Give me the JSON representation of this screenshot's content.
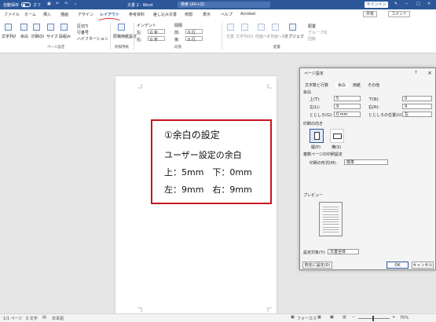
{
  "titlebar": {
    "autosave": "自動保存",
    "autosave_state": "オフ",
    "doc": "文書 2 - Word",
    "search": "検索 (Alt+Q)",
    "signin": "サインイン"
  },
  "tabs": [
    "ファイル",
    "ホーム",
    "挿入",
    "描画",
    "デザイン",
    "レイアウト",
    "参考資料",
    "差し込み文書",
    "校閲",
    "表示",
    "ヘルプ",
    "Acrobat"
  ],
  "share": "共有",
  "comment": "コメント",
  "ribbon": {
    "page_setup_buttons": [
      "文字列の方向",
      "余白",
      "印刷の向き",
      "サイズ",
      "段組み"
    ],
    "breaks": "区切り",
    "line_numbers": "行番号",
    "hyphenation": "ハイフネーション",
    "draft": "原稿用紙設定",
    "indent_label": "インデント",
    "indent_left": "左:",
    "indent_right": "右:",
    "indent_left_value": "0 字",
    "indent_right_value": "0 字",
    "spacing_label": "間隔",
    "spacing_before": "前:",
    "spacing_after": "後:",
    "spacing_before_value": "0 行",
    "spacing_after_value": "0 行",
    "arrange": [
      "位置",
      "文字列の折り返し",
      "前面へ移動",
      "背面へ移動",
      "オブジェクトの選択と表示",
      "配置",
      "グループ化",
      "回転"
    ],
    "groups": {
      "page_setup": "ページ設定",
      "draft": "原稿用紙",
      "paragraph": "段落",
      "arrange": "配置"
    }
  },
  "note": {
    "title": "①余白の設定",
    "subtitle": "ユーザー設定の余白",
    "line1": "上：5mm　下：0mm",
    "line2": "左：9mm　右：9mm"
  },
  "dialog": {
    "title": "ページ設定",
    "help": "?",
    "close": "×",
    "tabs": [
      "文字数と行数",
      "余白",
      "用紙",
      "その他"
    ],
    "margins_label": "余白",
    "top": "上(T):",
    "top_value": "5",
    "bottom": "下(B):",
    "bottom_value": "0",
    "left": "左(L):",
    "left_value": "9",
    "right": "右(R):",
    "right_value": "9",
    "gutter": "とじしろ(G):",
    "gutter_value": "0 mm",
    "gutter_pos": "とじしろの位置(U):",
    "gutter_pos_value": "左",
    "orientation_label": "印刷の向き",
    "portrait": "縦(P)",
    "landscape": "横(S)",
    "multi_label": "複数ページの印刷設定",
    "multi_field": "印刷の形式(M):",
    "multi_value": "標準",
    "preview": "プレビュー",
    "apply_label": "設定対象(Y):",
    "apply_value": "文書全体",
    "default_btn": "既定に設定(D)",
    "ok": "OK",
    "cancel": "キャンセル"
  },
  "status": {
    "page": "1/1 ページ",
    "words": "0 文字",
    "lang": "日本語",
    "focus": "フォーカス",
    "zoom": "70%"
  },
  "colors": {
    "accent": "#2b579a",
    "highlight": "#c8141e"
  }
}
